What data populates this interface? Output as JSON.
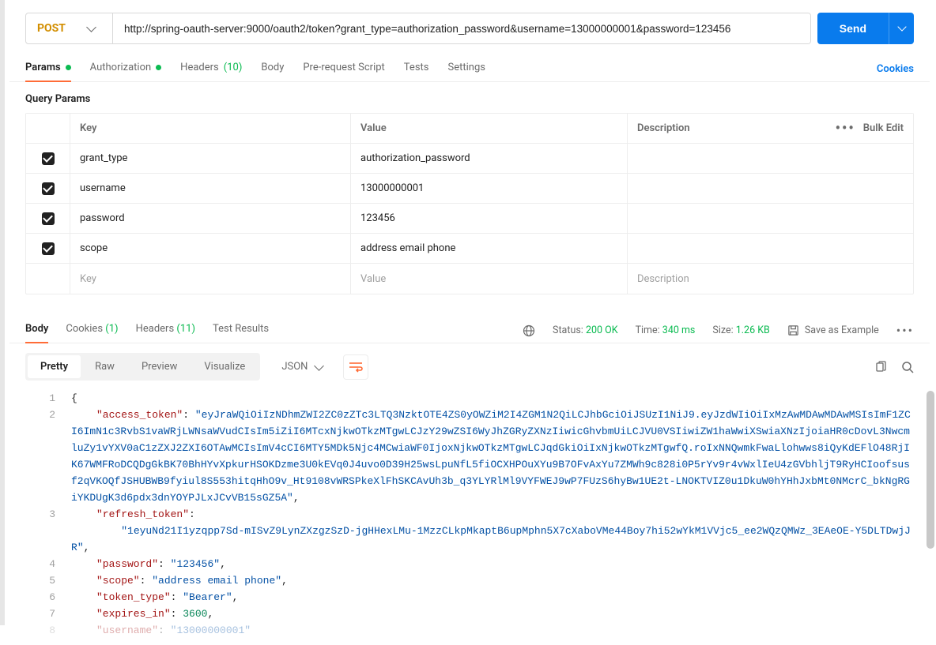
{
  "request": {
    "method": "POST",
    "url": "http://spring-oauth-server:9000/oauth2/token?grant_type=authorization_password&username=13000000001&password=123456",
    "url_suffix": "…",
    "send_label": "Send"
  },
  "req_tabs": {
    "params": "Params",
    "authorization": "Authorization",
    "headers": "Headers",
    "headers_count": "(10)",
    "body": "Body",
    "prerequest": "Pre-request Script",
    "tests": "Tests",
    "settings": "Settings",
    "cookies": "Cookies"
  },
  "params_section": {
    "title": "Query Params",
    "headers": {
      "key": "Key",
      "value": "Value",
      "description": "Description"
    },
    "bulk_edit": "Bulk Edit",
    "rows": [
      {
        "key": "grant_type",
        "value": "authorization_password",
        "desc": ""
      },
      {
        "key": "username",
        "value": "13000000001",
        "desc": ""
      },
      {
        "key": "password",
        "value": "123456",
        "desc": ""
      },
      {
        "key": "scope",
        "value": "address email phone",
        "desc": ""
      }
    ],
    "placeholders": {
      "key": "Key",
      "value": "Value",
      "desc": "Description"
    }
  },
  "response_tabs": {
    "body": "Body",
    "cookies": "Cookies",
    "cookies_count": "(1)",
    "headers": "Headers",
    "headers_count": "(11)",
    "test_results": "Test Results"
  },
  "response_meta": {
    "status_label": "Status:",
    "status_value": "200 OK",
    "time_label": "Time:",
    "time_value": "340 ms",
    "size_label": "Size:",
    "size_value": "1.26 KB",
    "save_example": "Save as Example"
  },
  "view_tabs": {
    "pretty": "Pretty",
    "raw": "Raw",
    "preview": "Preview",
    "visualize": "Visualize",
    "lang": "JSON"
  },
  "response_body": {
    "access_token": "eyJraWQiOiIzNDhmZWI2ZC0zZTc3LTQ3NzktOTE4ZS0yOWZiM2I4ZGM1N2QiLCJhbGciOiJSUzI1NiJ9.eyJzdWIiOiIxMzAwMDAwMDAwMSIsImF1ZCI6ImN1c3RvbS1vaWRjLWNsaWVudCIsIm5iZiI6MTcxNjkwOTkzMTgwLCJzY29wZSI6WyJhZGRyZXNzIiwicGhvbmUiLCJVU0VSIiwiZW1haWwiXSwiaXNzIjoiaHR0cDovL3NwcmluZy1vYXV0aC1zZXJ2ZXI6OTAwMCIsImV4cCI6MTY5MDk5Njc4MCwiaWF0IjoxNjkwOTkzMTgwLCJqdGkiOiIxNjkwOTkzMTgwfQ.roIxNNQwmkFwaLlohwws8iQyKdEFlO48RjIK67WMFRoDCQDgGkBK70BhHYvXpkurHSOKDzme3U0kEVq0J4uvo0D39H25wsLpuNfL5fiOCXHPOuXYu9B7OFvAxYu7ZMWh9c828i0P5rYv9r4vWxlIeU4zGVbhljT9RyHCIoofsusf2qVKOQfJSHUBWB9fyiul8S553hitqHhO9v_Ht9108vWRSPkeXlFhSKCAvUh3b_q3YLYRlMl9VYFWEJ9wP7FUzS6hyBw1UE2t-LNOKTVIZ0u1DkuW0hYHhJxbMt0NMcrC_bkNgRGiYKDUgK3d6pdx3dnYOYPJLxJCvVB15sGZ5A",
    "refresh_token": "1eyuNd21I1yzqpp7Sd-mISvZ9LynZXzgzSzD-jgHHexLMu-1MzzCLkpMkaptB6upMphn5X7cXaboVMe44Boy7hi52wYkM1VVjc5_ee2WQzQMWz_3EAeOE-Y5DLTDwjJR",
    "password": "123456",
    "scope": "address email phone",
    "token_type": "Bearer",
    "expires_in": 3600,
    "username_partial": "13000000001"
  }
}
